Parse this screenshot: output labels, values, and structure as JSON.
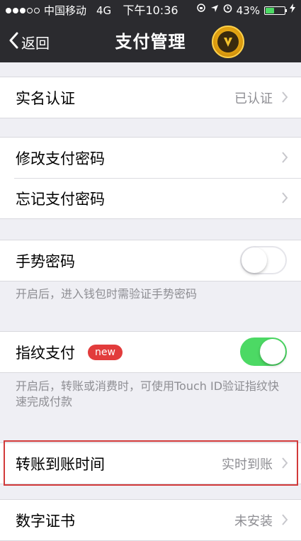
{
  "status_bar": {
    "carrier": "中国移动",
    "network": "4G",
    "time": "下午10:36",
    "battery": "43%",
    "icons": [
      "rotation-lock-icon",
      "location-icon",
      "alarm-icon",
      "charging-icon"
    ]
  },
  "nav": {
    "back_label": "返回",
    "title": "支付管理",
    "logo_icon": "gold-badge-icon"
  },
  "rows": {
    "realname": {
      "label": "实名认证",
      "value": "已认证"
    },
    "change_pwd": {
      "label": "修改支付密码"
    },
    "forgot_pwd": {
      "label": "忘记支付密码"
    },
    "gesture": {
      "label": "手势密码",
      "enabled": false,
      "note": "开启后，进入钱包时需验证手势密码"
    },
    "fingerprint": {
      "label": "指纹支付",
      "badge": "new",
      "enabled": true,
      "note": "开启后，转账或消费时，可使用Touch ID验证指纹快速完成付款"
    },
    "transfer_time": {
      "label": "转账到账时间",
      "value": "实时到账"
    },
    "certificate": {
      "label": "数字证书",
      "value": "未安装"
    }
  },
  "colors": {
    "header_bg": "#2b2b2f",
    "toggle_on": "#4cd964",
    "badge_red": "#e23c3c",
    "highlight": "#d23a3a"
  }
}
